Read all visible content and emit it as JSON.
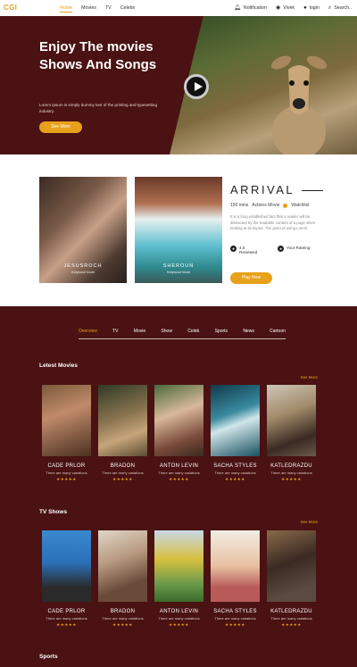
{
  "nav": {
    "logo": "CGI",
    "links": [
      "Home",
      "Movies",
      "TV",
      "Celebs"
    ],
    "notification": "Notification",
    "vivek": "Vivek",
    "login": "login",
    "search": "Search.."
  },
  "hero": {
    "title": "Enjoy The movies Shows And Songs",
    "description": "Lorem ipsum is simply dummy text of the printing and typesetting industry.",
    "button": "See More"
  },
  "feature": {
    "poster1_title": "JESUSROCH",
    "poster1_sub": "Hollywood Movie",
    "poster2_title": "SHEROUN",
    "poster2_sub": "Hollywood Movie",
    "title": "ARRIVAL",
    "runtime": "150 mins",
    "genre": "Actions Movie",
    "watchlist": "Watchlist",
    "description": "It is a long established fact that a reader will be distracted by the readable content of a page when looking at its layout. The point of using Lorem",
    "reviews_count": "4.5",
    "reviews_label": "Reviewed",
    "rating_label": "Your Rateing",
    "button": "Play Now"
  },
  "tabs": [
    "Overview",
    "TV",
    "Movie",
    "Show",
    "Celeb",
    "Sports",
    "News",
    "Cartoon"
  ],
  "latest": {
    "title": "Letest Movies",
    "more": "See More",
    "cards": [
      {
        "name": "CADE PRLOR",
        "desc": "There are many variations",
        "stars": "★★★★★"
      },
      {
        "name": "BRADON",
        "desc": "There are many variations",
        "stars": "★★★★★"
      },
      {
        "name": "ANTON LEVIN",
        "desc": "There are many variations",
        "stars": "★★★★★"
      },
      {
        "name": "SACHA STYLES",
        "desc": "There are many variations",
        "stars": "★★★★★"
      },
      {
        "name": "KATLEDRAZDU",
        "desc": "There are many variations",
        "stars": "★★★★★"
      }
    ]
  },
  "tvshows": {
    "title": "TV Shows",
    "more": "See More",
    "cards": [
      {
        "name": "CADE PRLOR",
        "desc": "There are many variations",
        "stars": "★★★★★"
      },
      {
        "name": "BRADON",
        "desc": "There are many variations",
        "stars": "★★★★★"
      },
      {
        "name": "ANTON LEVIN",
        "desc": "There are many variations",
        "stars": "★★★★★"
      },
      {
        "name": "SACHA STYLES",
        "desc": "There are many variations",
        "stars": "★★★★★"
      },
      {
        "name": "KATLEDRAZDU",
        "desc": "There are many variations",
        "stars": "★★★★★"
      }
    ]
  },
  "sports": {
    "title": "Sports"
  },
  "colors": {
    "accent": "#e7a11a",
    "background": "#4a1212"
  }
}
